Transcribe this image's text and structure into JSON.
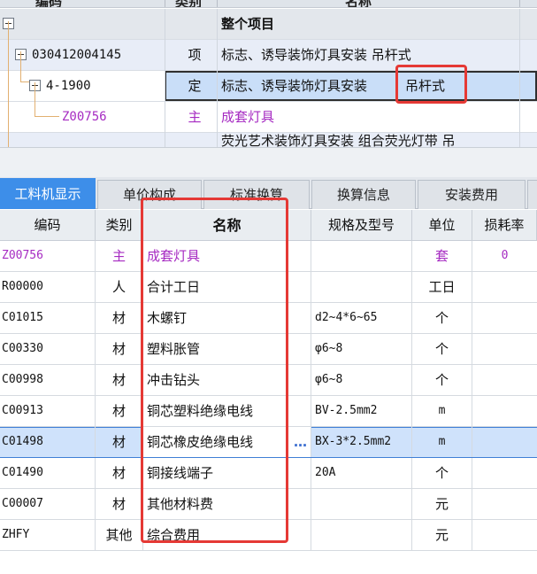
{
  "top": {
    "header": {
      "col_code": "编码",
      "col_type": "类别",
      "col_name": "名称"
    },
    "rows": [
      {
        "code": "",
        "type": "",
        "name": "整个项目"
      },
      {
        "code": "030412004145",
        "type": "项",
        "name": "标志、诱导装饰灯具安装 吊杆式"
      },
      {
        "code": "4-1900",
        "type": "定",
        "name_main": "标志、诱导装饰灯具安装",
        "name_tail": "吊杆式"
      },
      {
        "code": "Z00756",
        "type": "主",
        "name": "成套灯具"
      },
      {
        "code": "",
        "type": "",
        "name": "荧光艺术装饰灯具安装 组合荧光灯带 吊"
      }
    ]
  },
  "tabs": [
    {
      "label": "工料机显示"
    },
    {
      "label": "单价构成"
    },
    {
      "label": "标准换算"
    },
    {
      "label": "换算信息"
    },
    {
      "label": "安装费用"
    }
  ],
  "grid": {
    "headers": {
      "code": "编码",
      "type": "类别",
      "name": "名称",
      "spec": "规格及型号",
      "unit": "单位",
      "loss": "损耗率"
    },
    "rows": [
      {
        "code": "Z00756",
        "type": "主",
        "name": "成套灯具",
        "spec": "",
        "unit": "套",
        "loss": "0"
      },
      {
        "code": "R00000",
        "type": "人",
        "name": "合计工日",
        "spec": "",
        "unit": "工日",
        "loss": ""
      },
      {
        "code": "C01015",
        "type": "材",
        "name": "木螺钉",
        "spec": "d2~4*6~65",
        "unit": "个",
        "loss": ""
      },
      {
        "code": "C00330",
        "type": "材",
        "name": "塑料胀管",
        "spec": "φ6~8",
        "unit": "个",
        "loss": ""
      },
      {
        "code": "C00998",
        "type": "材",
        "name": "冲击钻头",
        "spec": "φ6~8",
        "unit": "个",
        "loss": ""
      },
      {
        "code": "C00913",
        "type": "材",
        "name": "铜芯塑料绝缘电线",
        "spec": "BV-2.5mm2",
        "unit": "m",
        "loss": ""
      },
      {
        "code": "C01498",
        "type": "材",
        "name": "铜芯橡皮绝缘电线",
        "spec": "BX-3*2.5mm2",
        "unit": "m",
        "loss": "",
        "ellipsis": "…"
      },
      {
        "code": "C01490",
        "type": "材",
        "name": "铜接线端子",
        "spec": "20A",
        "unit": "个",
        "loss": ""
      },
      {
        "code": "C00007",
        "type": "材",
        "name": "其他材料费",
        "spec": "",
        "unit": "元",
        "loss": ""
      },
      {
        "code": "ZHFY",
        "type": "其他",
        "name": "综合费用",
        "spec": "",
        "unit": "元",
        "loss": ""
      }
    ]
  },
  "colors": {
    "accent": "#3d8ee9",
    "highlight": "#e53935",
    "purple": "#a62bc2",
    "selected_row": "#cfe2fb"
  }
}
